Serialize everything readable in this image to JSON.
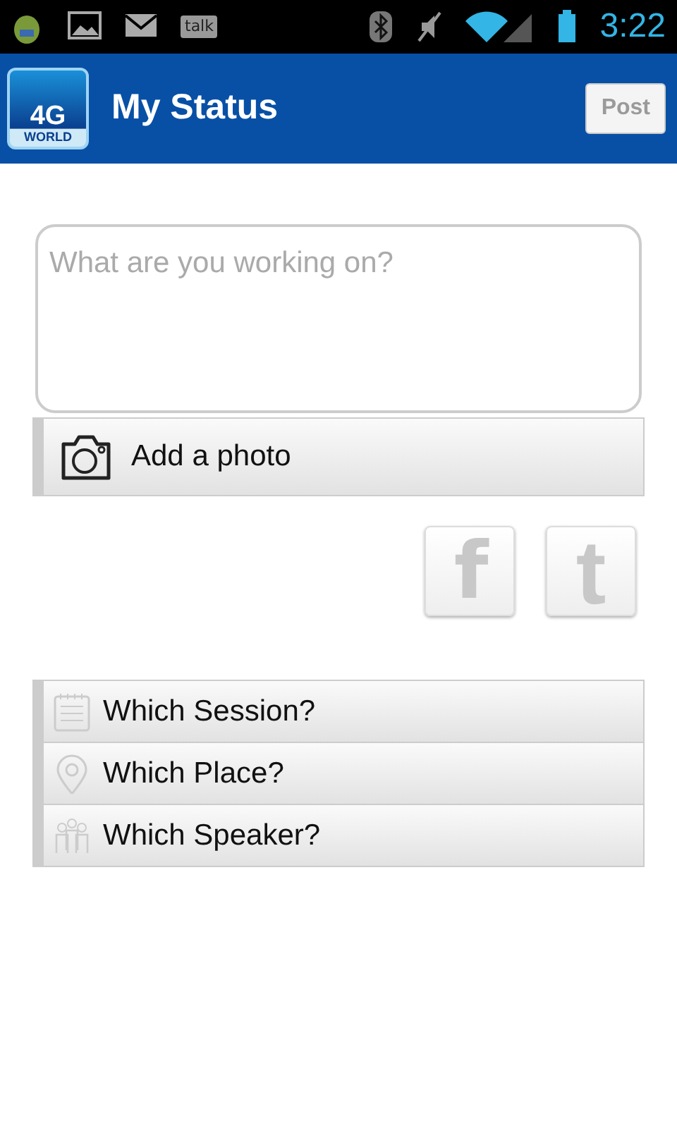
{
  "status_bar": {
    "notifications": [
      {
        "kind": "android"
      },
      {
        "kind": "image"
      },
      {
        "kind": "mail"
      },
      {
        "kind": "talk",
        "label": "talk"
      }
    ],
    "time": "3:22"
  },
  "header": {
    "logo": {
      "line1": "4G",
      "line2": "WORLD"
    },
    "title": "My Status",
    "post_button": {
      "label": "Post",
      "disabled": true
    }
  },
  "status_field": {
    "placeholder": "What are you working on?"
  },
  "add_photo": {
    "label": "Add a photo"
  },
  "share": [
    {
      "kind": "facebook",
      "glyph": "f",
      "selected": false
    },
    {
      "kind": "twitter",
      "glyph": "t",
      "selected": false
    }
  ],
  "options": [
    {
      "kind": "session",
      "label": "Which Session?"
    },
    {
      "kind": "place",
      "label": "Which Place?"
    },
    {
      "kind": "speaker",
      "label": "Which Speaker?"
    }
  ]
}
